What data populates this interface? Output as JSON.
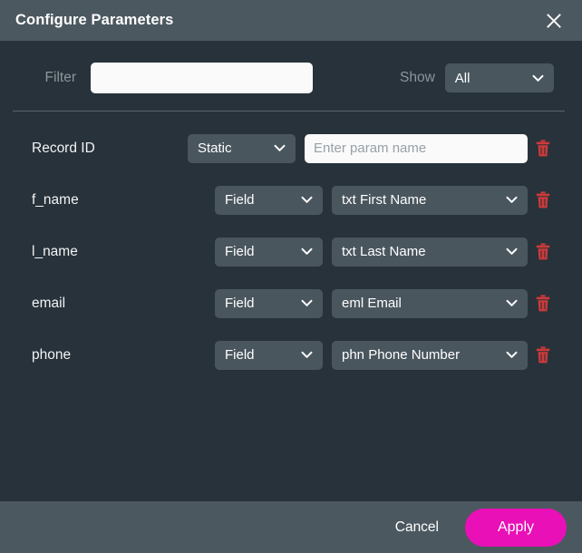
{
  "dialog": {
    "title": "Configure Parameters",
    "close_icon": "close-icon"
  },
  "toolbar": {
    "filter_label": "Filter",
    "filter_value": "",
    "filter_placeholder": "",
    "show_label": "Show",
    "show_value": "All",
    "chevron_icon": "chevron-down-icon"
  },
  "colors": {
    "header_bg": "#4c585f",
    "body_bg": "#28323a",
    "select_bg": "#4a565e",
    "accent": "#e810b6",
    "delete_icon": "#cf3a3a",
    "divider": "#57646b"
  },
  "rows": [
    {
      "name": "Record ID",
      "type": "Static",
      "value": "",
      "value_placeholder": "Enter param name",
      "value_kind": "input",
      "delete_icon": "trash-icon"
    },
    {
      "name": "f_name",
      "type": "Field",
      "value": "txt First Name",
      "value_kind": "select",
      "delete_icon": "trash-icon"
    },
    {
      "name": "l_name",
      "type": "Field",
      "value": "txt Last Name",
      "value_kind": "select",
      "delete_icon": "trash-icon"
    },
    {
      "name": "email",
      "type": "Field",
      "value": "eml Email",
      "value_kind": "select",
      "delete_icon": "trash-icon"
    },
    {
      "name": "phone",
      "type": "Field",
      "value": "phn Phone Number",
      "value_kind": "select",
      "delete_icon": "trash-icon"
    }
  ],
  "footer": {
    "cancel_label": "Cancel",
    "apply_label": "Apply"
  }
}
